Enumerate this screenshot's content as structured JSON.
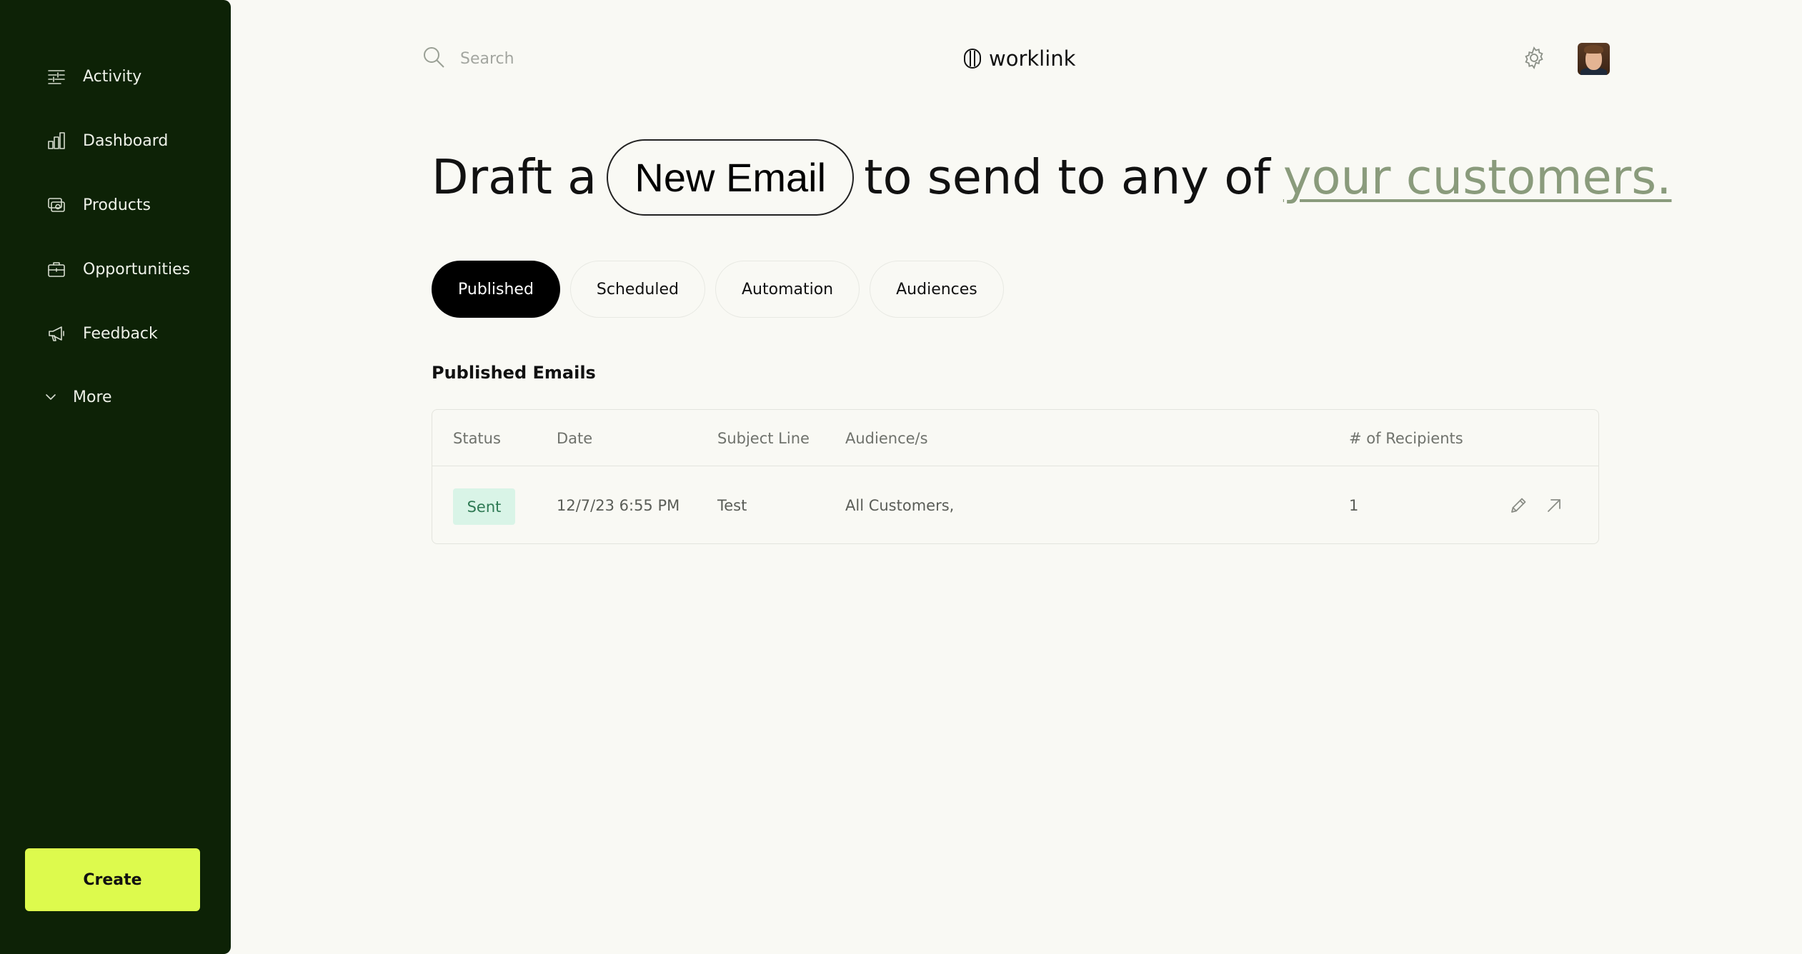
{
  "sidebar": {
    "items": [
      {
        "label": "Activity",
        "icon": "activity-icon"
      },
      {
        "label": "Dashboard",
        "icon": "bar-chart-icon"
      },
      {
        "label": "Products",
        "icon": "products-icon"
      },
      {
        "label": "Opportunities",
        "icon": "briefcase-icon"
      },
      {
        "label": "Feedback",
        "icon": "megaphone-icon"
      }
    ],
    "more_label": "More",
    "create_label": "Create"
  },
  "header": {
    "search_placeholder": "Search",
    "logo_text": "worklink"
  },
  "headline": {
    "prefix": "Draft a",
    "pill": "New Email",
    "middle": "to send to any of",
    "link": "your customers."
  },
  "tabs": [
    {
      "label": "Published",
      "active": true
    },
    {
      "label": "Scheduled",
      "active": false
    },
    {
      "label": "Automation",
      "active": false
    },
    {
      "label": "Audiences",
      "active": false
    }
  ],
  "section_title": "Published Emails",
  "table": {
    "headers": [
      "Status",
      "Date",
      "Subject Line",
      "Audience/s",
      "# of Recipients"
    ],
    "rows": [
      {
        "status": "Sent",
        "date": "12/7/23 6:55 PM",
        "subject": "Test",
        "audience": "All Customers,",
        "recipients": "1"
      }
    ]
  },
  "colors": {
    "sidebar_bg": "#0d2206",
    "create_button": "#ddfa4d",
    "page_bg": "#f9f9f4",
    "link": "#8a9b7c",
    "badge_bg": "#d9f4e7",
    "badge_text": "#2f7a54"
  }
}
